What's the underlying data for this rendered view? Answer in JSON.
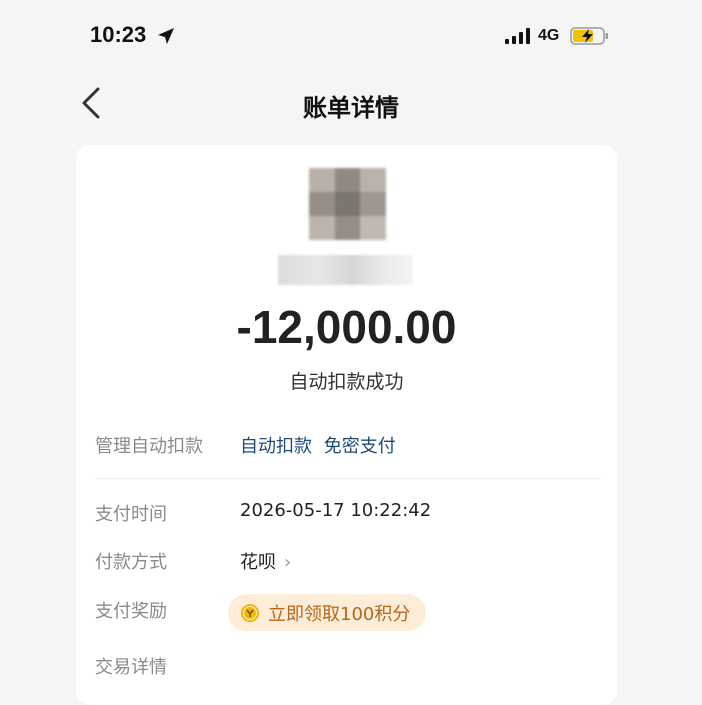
{
  "status_bar": {
    "time": "10:23",
    "network": "4G"
  },
  "nav": {
    "title": "账单详情"
  },
  "bill": {
    "amount": "-12,000.00",
    "status": "自动扣款成功"
  },
  "manage": {
    "label": "管理自动扣款",
    "link1": "自动扣款",
    "link2": "免密支付"
  },
  "details": {
    "pay_time_label": "支付时间",
    "pay_time_value": "2026-05-17 10:22:42",
    "method_label": "付款方式",
    "method_value": "花呗",
    "reward_label": "支付奖励",
    "reward_value": "立即领取100积分",
    "trade_label": "交易详情"
  },
  "icons": {
    "location": "location-arrow-icon",
    "signal": "signal-bars-icon",
    "battery": "battery-charging-icon",
    "back": "back-chevron-icon",
    "chevron": "chevron-right-icon",
    "coin": "coin-icon"
  },
  "colors": {
    "link": "#1f4b7a",
    "reward_bg": "#fdecd8",
    "reward_text": "#b8671a",
    "coin": "#f2b705"
  }
}
